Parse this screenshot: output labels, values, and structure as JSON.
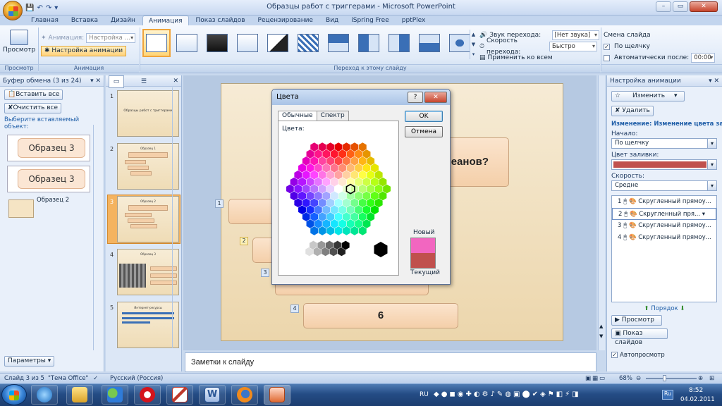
{
  "window": {
    "title": "Образцы работ с триггерами - Microsoft PowerPoint",
    "minimize": "–",
    "maximize": "▭",
    "close": "✕"
  },
  "tabs": [
    "Главная",
    "Вставка",
    "Дизайн",
    "Анимация",
    "Показ слайдов",
    "Рецензирование",
    "Вид",
    "iSpring Free",
    "pptPlex"
  ],
  "active_tab": "Анимация",
  "ribbon": {
    "preview_label": "Просмотр",
    "preview_group": "Просмотр",
    "animation_label": "Анимация:",
    "animation_value": "Настройка ...",
    "custom_animation": "Настройка анимации",
    "animation_group": "Анимация",
    "transition_group": "Переход к этому слайду",
    "sound_label": "Звук перехода:",
    "sound_value": "[Нет звука]",
    "speed_label": "Скорость перехода:",
    "speed_value": "Быстро",
    "apply_all": "Применить ко всем",
    "advance_header": "Смена слайда",
    "on_click": "По щелчку",
    "auto_after": "Автоматически после:",
    "auto_time": "00:00"
  },
  "clipboard": {
    "title": "Буфер обмена (3 из 24)",
    "paste_all": "Вставить все",
    "clear_all": "Очистить все",
    "select_prompt": "Выберите вставляемый объект:",
    "items": [
      "Образец 3",
      "Образец 3",
      "Образец 2"
    ],
    "options": "Параметры ▾"
  },
  "thumbnails": [
    {
      "num": "1",
      "title": "Образцы работ с триггерами"
    },
    {
      "num": "2",
      "title": "Образец 1"
    },
    {
      "num": "3",
      "title": "Образец 2"
    },
    {
      "num": "4",
      "title": "Образец 3"
    },
    {
      "num": "5",
      "title": "Интернет-ресурсы"
    }
  ],
  "slide": {
    "question_fragment": "еанов?",
    "answer_bottom": "6",
    "tags": [
      "1",
      "2",
      "3",
      "4"
    ]
  },
  "notes": "Заметки к слайду",
  "animation_pane": {
    "title": "Настройка анимации",
    "change_btn": "Изменить",
    "remove_btn": "Удалить",
    "effect_title": "Изменение: Изменение цвета зали",
    "start_label": "Начало:",
    "start_value": "По щелчку",
    "fill_label": "Цвет заливки:",
    "fill_color": "#c0504d",
    "speed_label": "Скорость:",
    "speed_value": "Средне",
    "items": [
      {
        "num": "1",
        "label": "Скругленный прямоу..."
      },
      {
        "num": "2",
        "label": "Скругленный пря..."
      },
      {
        "num": "3",
        "label": "Скругленный прямоу..."
      },
      {
        "num": "4",
        "label": "Скругленный прямоу..."
      }
    ],
    "order_label": "Порядок",
    "play_btn": "Просмотр",
    "slideshow_btn": "Показ слайдов",
    "autopreview": "Автопросмотр"
  },
  "status": {
    "slide_info": "Слайд 3 из 5",
    "theme": "\"Тема Office\"",
    "language": "Русский (Россия)",
    "zoom": "68%"
  },
  "dialog": {
    "title": "Цвета",
    "tab_standard": "Обычные",
    "tab_custom": "Спектр",
    "colors_label": "Цвета:",
    "ok": "OK",
    "cancel": "Отмена",
    "new_label": "Новый",
    "current_label": "Текущий",
    "new_color": "#f266c0",
    "current_color": "#c0504d"
  },
  "taskbar": {
    "lang": "RU",
    "time": "8:52",
    "date": "04.02.2011"
  }
}
